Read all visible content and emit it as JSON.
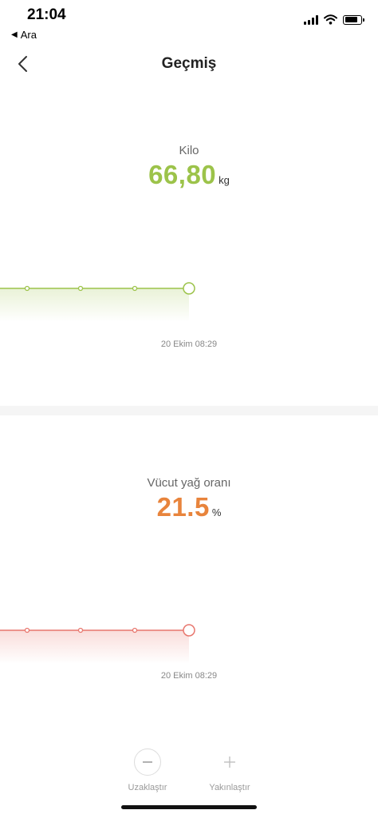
{
  "status_bar": {
    "time": "21:04",
    "back_app": "Ara"
  },
  "nav": {
    "title": "Geçmiş"
  },
  "weight": {
    "label": "Kilo",
    "value": "66,80",
    "unit": "kg",
    "date": "20 Ekim 08:29",
    "color": "#9CC34A"
  },
  "body_fat": {
    "label": "Vücut yağ oranı",
    "value": "21.5",
    "unit": "%",
    "date": "20 Ekim 08:29",
    "color": "#E8843C",
    "line_color": "#E8776E"
  },
  "controls": {
    "zoom_out": "Uzaklaştır",
    "zoom_in": "Yakınlaştır"
  },
  "icons": {
    "back": "chevron-left-icon",
    "zoom_out": "minus-icon",
    "zoom_in": "plus-icon"
  }
}
